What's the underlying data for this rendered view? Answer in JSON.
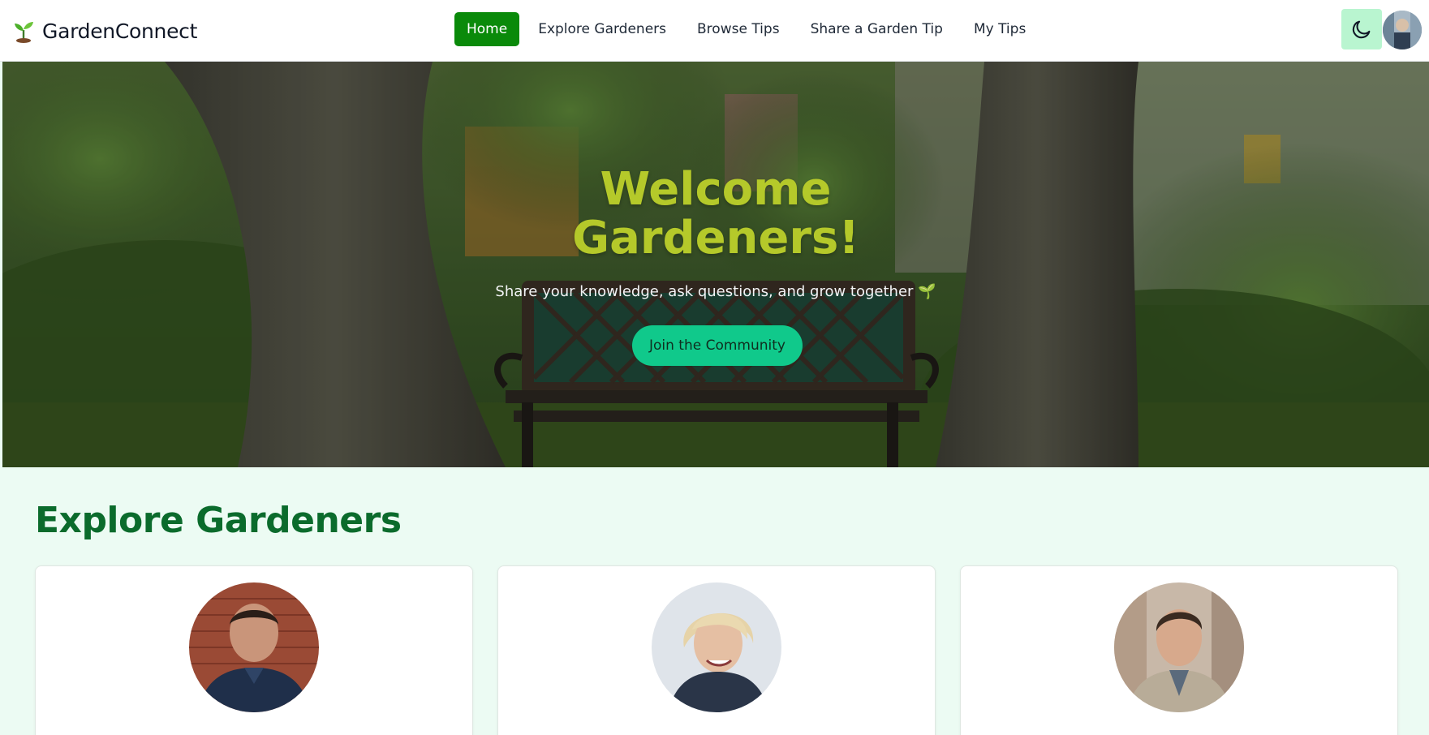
{
  "brand": {
    "name": "GardenConnect",
    "icon": "seedling-icon"
  },
  "nav": {
    "links": [
      {
        "label": "Home",
        "active": true
      },
      {
        "label": "Explore Gardeners",
        "active": false
      },
      {
        "label": "Browse Tips",
        "active": false
      },
      {
        "label": "Share a Garden Tip",
        "active": false
      },
      {
        "label": "My Tips",
        "active": false
      }
    ],
    "theme_toggle_icon": "moon-icon",
    "avatar_icon": "user-avatar"
  },
  "hero": {
    "title": "Welcome Gardeners!",
    "subtitle": "Share your knowledge, ask questions, and grow together 🌱",
    "button_label": "Join the Community"
  },
  "explore": {
    "title": "Explore Gardeners",
    "gardeners": [
      {
        "avatar": "gardener-photo"
      },
      {
        "avatar": "gardener-photo"
      },
      {
        "avatar": "gardener-photo"
      }
    ]
  },
  "colors": {
    "nav_active": "#0a8a0a",
    "hero_title": "#b5c92a",
    "hero_button": "#10c98b",
    "section_title": "#0b6b2c",
    "page_background": "#ecfbf3",
    "theme_toggle": "#b9f5d0"
  }
}
